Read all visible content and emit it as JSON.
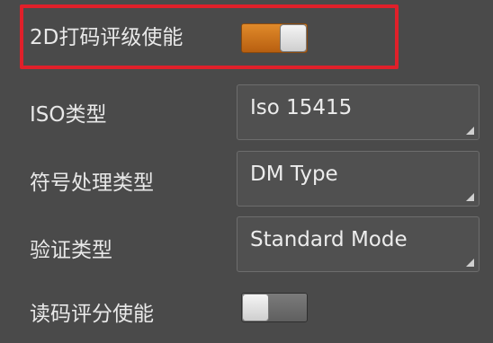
{
  "settings": {
    "dpm_grading": {
      "label": "2D打码评级使能",
      "enabled": true
    },
    "iso_type": {
      "label": "ISO类型",
      "value": "Iso 15415"
    },
    "symbol_type": {
      "label": "符号处理类型",
      "value": "DM Type"
    },
    "verify_type": {
      "label": "验证类型",
      "value": "Standard Mode"
    },
    "read_grading": {
      "label": "读码评分使能",
      "enabled": false
    }
  },
  "colors": {
    "background": "#4a4a4a",
    "toggle_on": "#d0761c",
    "toggle_off": "#6c6c6c",
    "highlight_border": "#e0202a"
  },
  "icons": [
    "dropdown-corner-icon"
  ]
}
